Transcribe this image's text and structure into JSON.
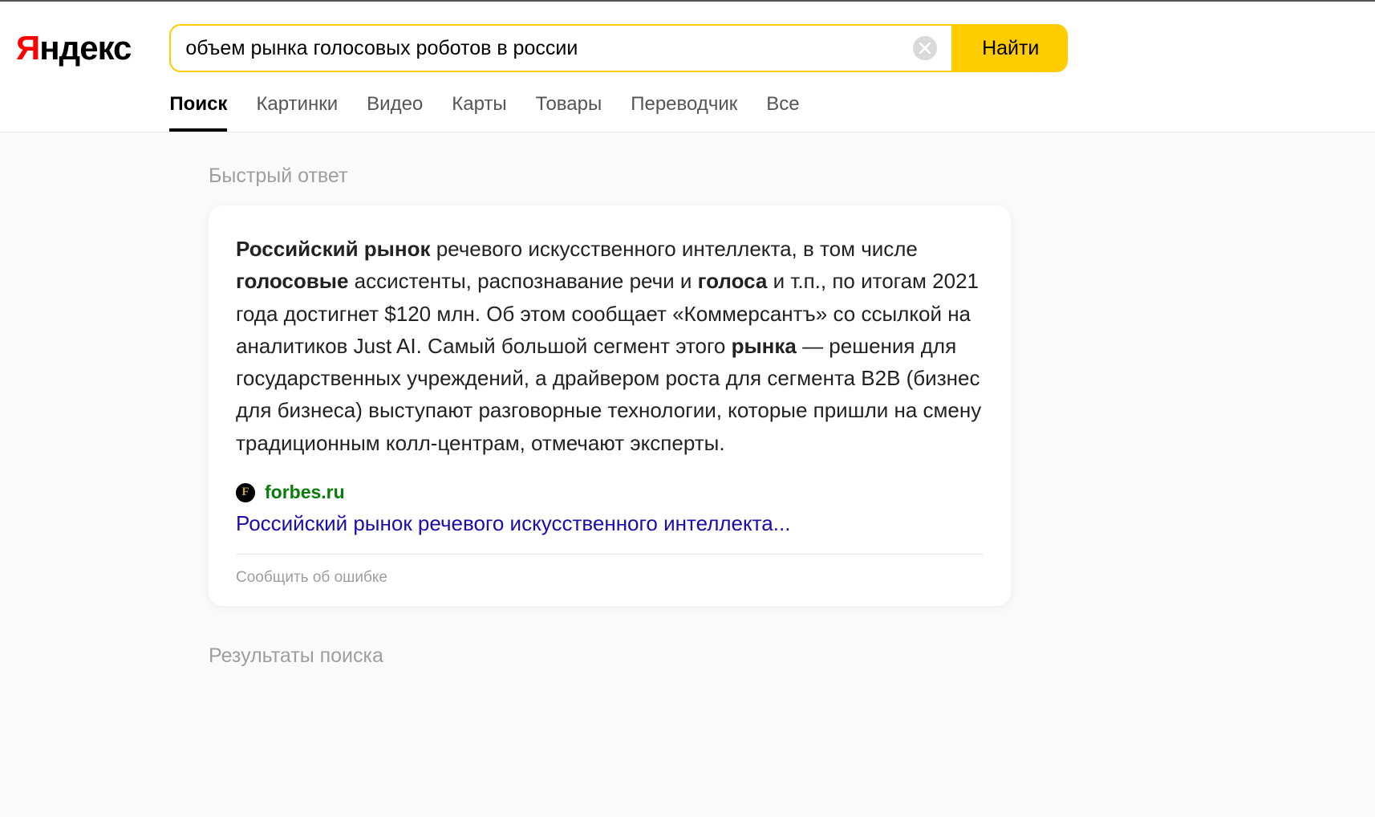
{
  "logo": {
    "first_char": "Я",
    "rest": "ндекс"
  },
  "search": {
    "query": "объем рынка голосовых роботов в россии",
    "button_label": "Найти"
  },
  "tabs": [
    {
      "label": "Поиск",
      "active": true
    },
    {
      "label": "Картинки",
      "active": false
    },
    {
      "label": "Видео",
      "active": false
    },
    {
      "label": "Карты",
      "active": false
    },
    {
      "label": "Товары",
      "active": false
    },
    {
      "label": "Переводчик",
      "active": false
    },
    {
      "label": "Все",
      "active": false
    }
  ],
  "quick_answer": {
    "label": "Быстрый ответ",
    "text_plain": "Российский рынок речевого искусственного интеллекта, в том числе голосовые ассистенты, распознавание речи и голоса и т.п., по итогам 2021 года достигнет $120 млн. Об этом сообщает «Коммерсантъ» со ссылкой на аналитиков Just AI. Самый большой сегмент этого рынка — решения для государственных учреждений, а драйвером роста для сегмента B2B (бизнес для бизнеса) выступают разговорные технологии, которые пришли на смену традиционным колл-центрам, отмечают эксперты.",
    "bold_phrases": [
      "Российский рынок",
      "голосовые",
      "голоса",
      "рынка"
    ],
    "source": {
      "favicon_letter": "F",
      "domain": "forbes.ru",
      "title": "Российский рынок речевого искусственного интеллекта..."
    },
    "report_label": "Сообщить об ошибке"
  },
  "results_label": "Результаты поиска"
}
